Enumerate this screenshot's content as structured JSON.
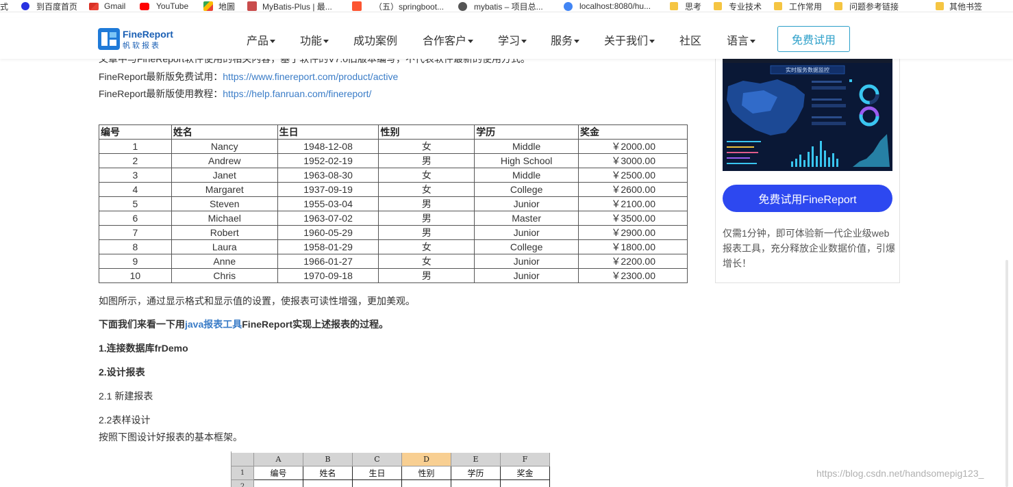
{
  "bookmarks": [
    {
      "label": "式",
      "icon": "none"
    },
    {
      "label": "到百度首页",
      "icon": "baidu-icon",
      "color": "#2932e1"
    },
    {
      "label": "Gmail",
      "icon": "gmail-icon",
      "color": "#d93025"
    },
    {
      "label": "YouTube",
      "icon": "youtube-icon",
      "color": "#ff0000"
    },
    {
      "label": "地圖",
      "icon": "maps-icon",
      "color": "#34a853"
    },
    {
      "label": "MyBatis-Plus | 最...",
      "icon": "mybatis-plus-icon",
      "color": "#c94c4c"
    },
    {
      "label": "（五）springboot...",
      "icon": "csdn-icon",
      "color": "#fc5531"
    },
    {
      "label": "mybatis – 项目总...",
      "icon": "globe-icon",
      "color": "#555555"
    },
    {
      "label": "localhost:8080/hu...",
      "icon": "localhost-icon",
      "color": "#4285f4"
    },
    {
      "label": "思考",
      "icon": "folder-icon"
    },
    {
      "label": "专业技术",
      "icon": "folder-icon"
    },
    {
      "label": "工作常用",
      "icon": "folder-icon"
    },
    {
      "label": "问题参考链接",
      "icon": "folder-icon"
    },
    {
      "label": "其他书签",
      "icon": "folder-icon"
    }
  ],
  "nav": {
    "logo_text": "FineReport",
    "logo_sub": "帆软报表",
    "items": [
      {
        "label": "产品",
        "caret": true
      },
      {
        "label": "功能",
        "caret": true
      },
      {
        "label": "成功案例",
        "caret": false
      },
      {
        "label": "合作客户",
        "caret": true
      },
      {
        "label": "学习",
        "caret": true
      },
      {
        "label": "服务",
        "caret": true
      },
      {
        "label": "关于我们",
        "caret": true
      },
      {
        "label": "社区",
        "caret": false
      },
      {
        "label": "语言",
        "caret": true
      }
    ],
    "trial_button": "免费试用"
  },
  "article": {
    "partial_top": "文章中与FineReport软件使用的相关内容，基于软件的V7.0旧版本编写，不代表软件最新的使用方式。",
    "trial_line_label": "FineReport最新版免费试用：",
    "trial_line_url": "https://www.finereport.com/product/active",
    "tutorial_line_label": "FineReport最新版使用教程：",
    "tutorial_line_url": "https://help.fanruan.com/finereport/",
    "caption": "如图所示，通过显示格式和显示值的设置，使报表可读性增强，更加美观。",
    "intro_prefix": "下面我们来看一下用",
    "intro_link": "java报表工具",
    "intro_suffix": "FineReport实现上述报表的过程。",
    "step1": "1.连接数据库frDemo",
    "step2": "2.设计报表",
    "step21": "2.1 新建报表",
    "step22": "2.2表样设计",
    "step22_desc": "按照下图设计好报表的基本框架。"
  },
  "table": {
    "headers": [
      "编号",
      "姓名",
      "生日",
      "性别",
      "学历",
      "奖金"
    ],
    "rows": [
      [
        "1",
        "Nancy",
        "1948-12-08",
        "女",
        "Middle",
        "￥2000.00"
      ],
      [
        "2",
        "Andrew",
        "1952-02-19",
        "男",
        "High School",
        "￥3000.00"
      ],
      [
        "3",
        "Janet",
        "1963-08-30",
        "女",
        "Middle",
        "￥2500.00"
      ],
      [
        "4",
        "Margaret",
        "1937-09-19",
        "女",
        "College",
        "￥2600.00"
      ],
      [
        "5",
        "Steven",
        "1955-03-04",
        "男",
        "Junior",
        "￥2100.00"
      ],
      [
        "6",
        "Michael",
        "1963-07-02",
        "男",
        "Master",
        "￥3500.00"
      ],
      [
        "7",
        "Robert",
        "1960-05-29",
        "男",
        "Junior",
        "￥2900.00"
      ],
      [
        "8",
        "Laura",
        "1958-01-29",
        "女",
        "College",
        "￥1800.00"
      ],
      [
        "9",
        "Anne",
        "1966-01-27",
        "女",
        "Junior",
        "￥2200.00"
      ],
      [
        "10",
        "Chris",
        "1970-09-18",
        "男",
        "Junior",
        "￥2300.00"
      ]
    ]
  },
  "sidebar": {
    "dashboard_title": "实时服务数据监控",
    "cta_label": "免费试用FineReport",
    "description": "仅需1分钟，即可体验新一代企业级web报表工具，充分释放企业数据价值，引爆增长！"
  },
  "sheet": {
    "col_headers": [
      "A",
      "B",
      "C",
      "D",
      "E",
      "F"
    ],
    "selected_col": "D",
    "row_headers": [
      "1",
      "2"
    ],
    "row1": [
      "编号",
      "姓名",
      "生日",
      "性别",
      "学历",
      "奖金"
    ]
  },
  "watermark": "https://blog.csdn.net/handsomepig123_",
  "colors": {
    "accent": "#2b9fc9",
    "cta": "#2d48f0",
    "link": "#3a7cc7",
    "brand": "#1a5fb4"
  }
}
